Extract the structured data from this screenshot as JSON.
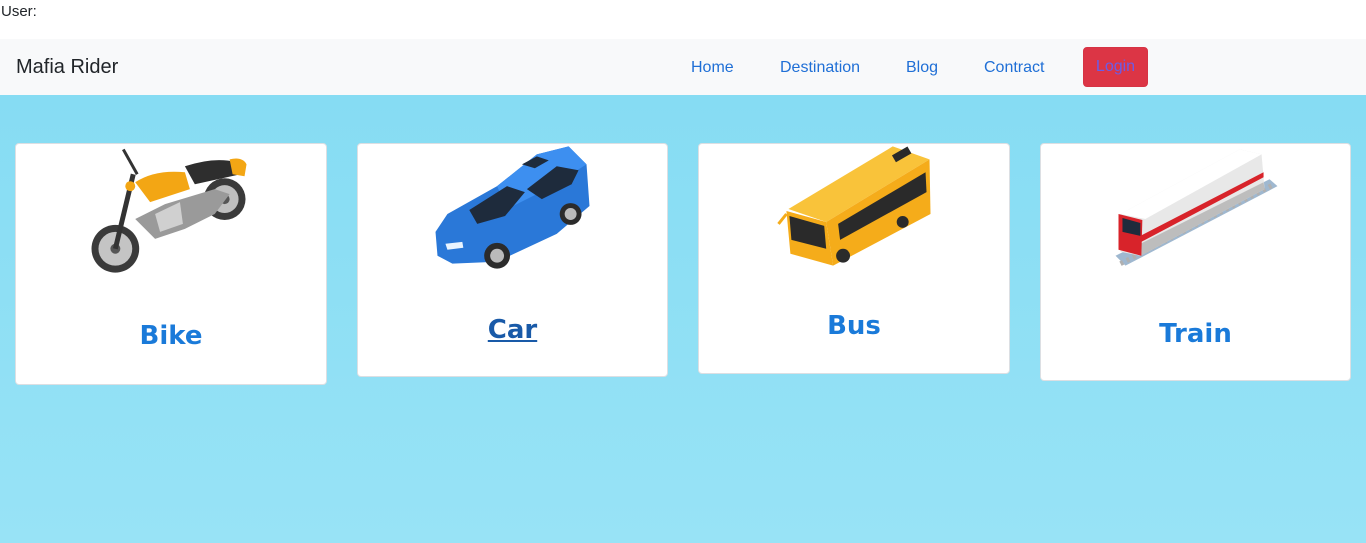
{
  "user_line": "User:",
  "navbar": {
    "brand": "Mafia Rider",
    "links": [
      "Home",
      "Destination",
      "Blog",
      "Contract"
    ],
    "login_label": "Login"
  },
  "cards": [
    {
      "title": "Bike",
      "icon": "motorbike-icon"
    },
    {
      "title": "Car",
      "icon": "car-icon"
    },
    {
      "title": "Bus",
      "icon": "bus-icon"
    },
    {
      "title": "Train",
      "icon": "train-icon"
    }
  ],
  "colors": {
    "accent": "#1a7ad9",
    "login_bg": "#dc3545",
    "hero_bg": "#86dcf3",
    "navbar_bg": "#f8f9fa"
  }
}
